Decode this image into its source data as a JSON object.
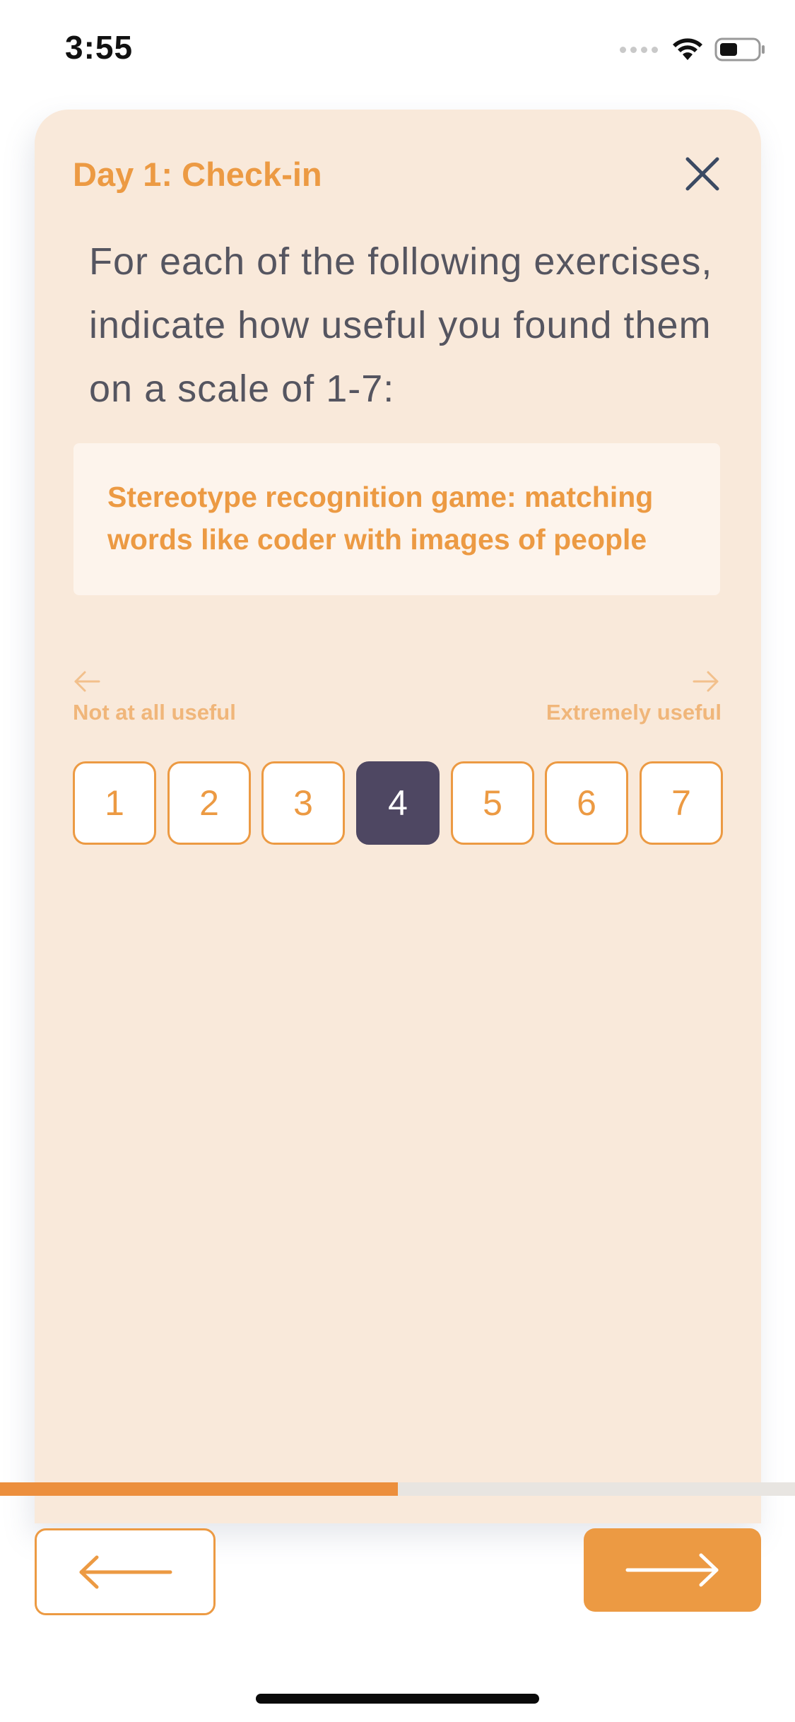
{
  "status_bar": {
    "time": "3:55",
    "icons": [
      "signal-dots-icon",
      "wifi-icon",
      "battery-icon"
    ]
  },
  "card": {
    "title": "Day 1: Check-in",
    "close_icon": "close-icon",
    "question": "For each of the following exercises, indicate how useful you found them on a scale of 1-7:",
    "exercise": "Stereotype recognition game: matching words like coder with images of people"
  },
  "scale": {
    "min_label": "Not at all useful",
    "max_label": "Extremely useful",
    "options": [
      "1",
      "2",
      "3",
      "4",
      "5",
      "6",
      "7"
    ],
    "selected": "4"
  },
  "progress": {
    "fraction": 0.5
  },
  "navigation": {
    "back_icon": "arrow-left-icon",
    "next_icon": "arrow-right-icon"
  },
  "colors": {
    "accent": "#ec9a43",
    "card_background": "#f9e9da",
    "selected": "#4e4762",
    "close_icon": "#3b4a63"
  }
}
